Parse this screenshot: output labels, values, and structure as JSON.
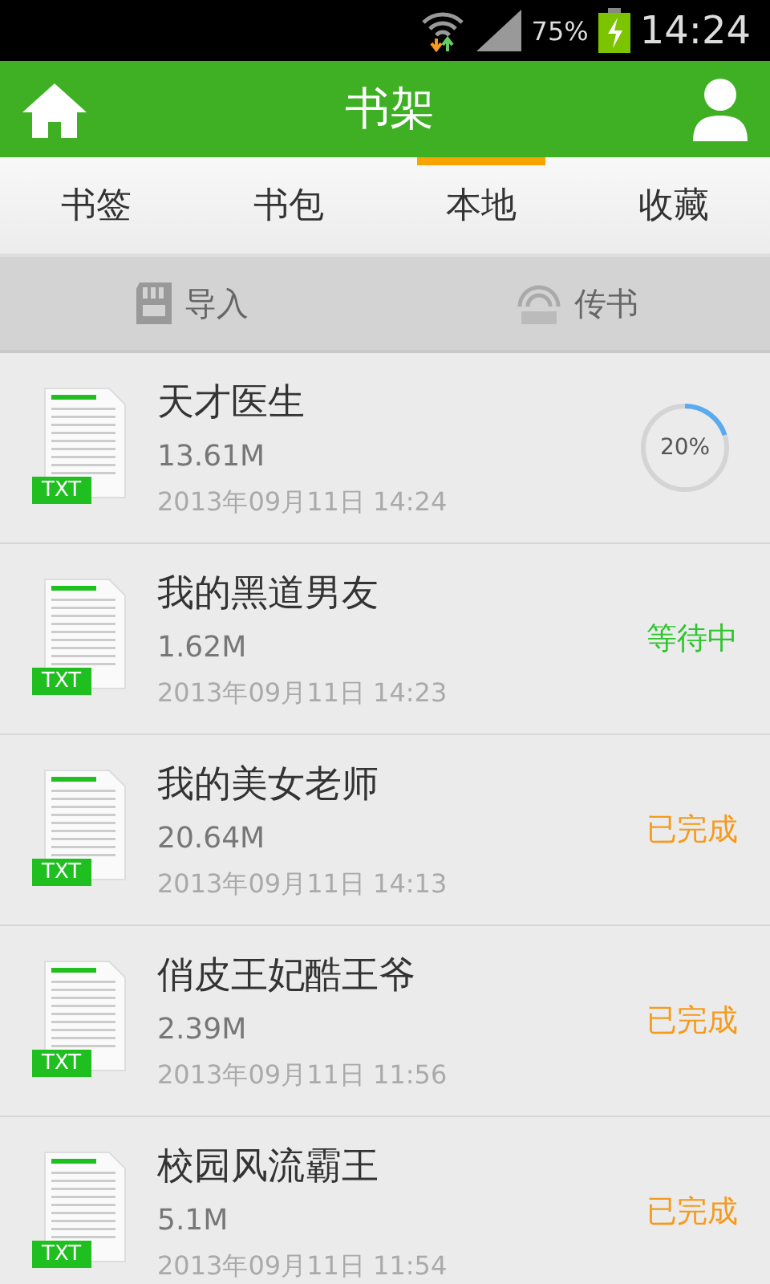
{
  "status_bar": {
    "battery": "75%",
    "time": "14:24"
  },
  "header": {
    "title": "书架"
  },
  "tabs": [
    {
      "label": "书签",
      "selected": false
    },
    {
      "label": "书包",
      "selected": false
    },
    {
      "label": "本地",
      "selected": true
    },
    {
      "label": "收藏",
      "selected": false
    }
  ],
  "actions": [
    {
      "kind": "import",
      "label": "导入"
    },
    {
      "kind": "wifi",
      "label": "传书"
    }
  ],
  "books": [
    {
      "badge": "TXT",
      "title": "天才医生",
      "size": "13.61M",
      "date": "2013年09月11日 14:24",
      "status": {
        "kind": "progress",
        "level": 0.2,
        "reading": "20%"
      }
    },
    {
      "badge": "TXT",
      "title": "我的黑道男友",
      "size": "1.62M",
      "date": "2013年09月11日 14:23",
      "status": {
        "kind": "waiting",
        "label": "等待中"
      }
    },
    {
      "badge": "TXT",
      "title": "我的美女老师",
      "size": "20.64M",
      "date": "2013年09月11日 14:13",
      "status": {
        "kind": "done",
        "label": "已完成"
      }
    },
    {
      "badge": "TXT",
      "title": "俏皮王妃酷王爷",
      "size": "2.39M",
      "date": "2013年09月11日 11:56",
      "status": {
        "kind": "done",
        "label": "已完成"
      }
    },
    {
      "badge": "TXT",
      "title": "校园风流霸王",
      "size": "5.1M",
      "date": "2013年09月11日 11:54",
      "status": {
        "kind": "done",
        "label": "已完成"
      }
    }
  ]
}
